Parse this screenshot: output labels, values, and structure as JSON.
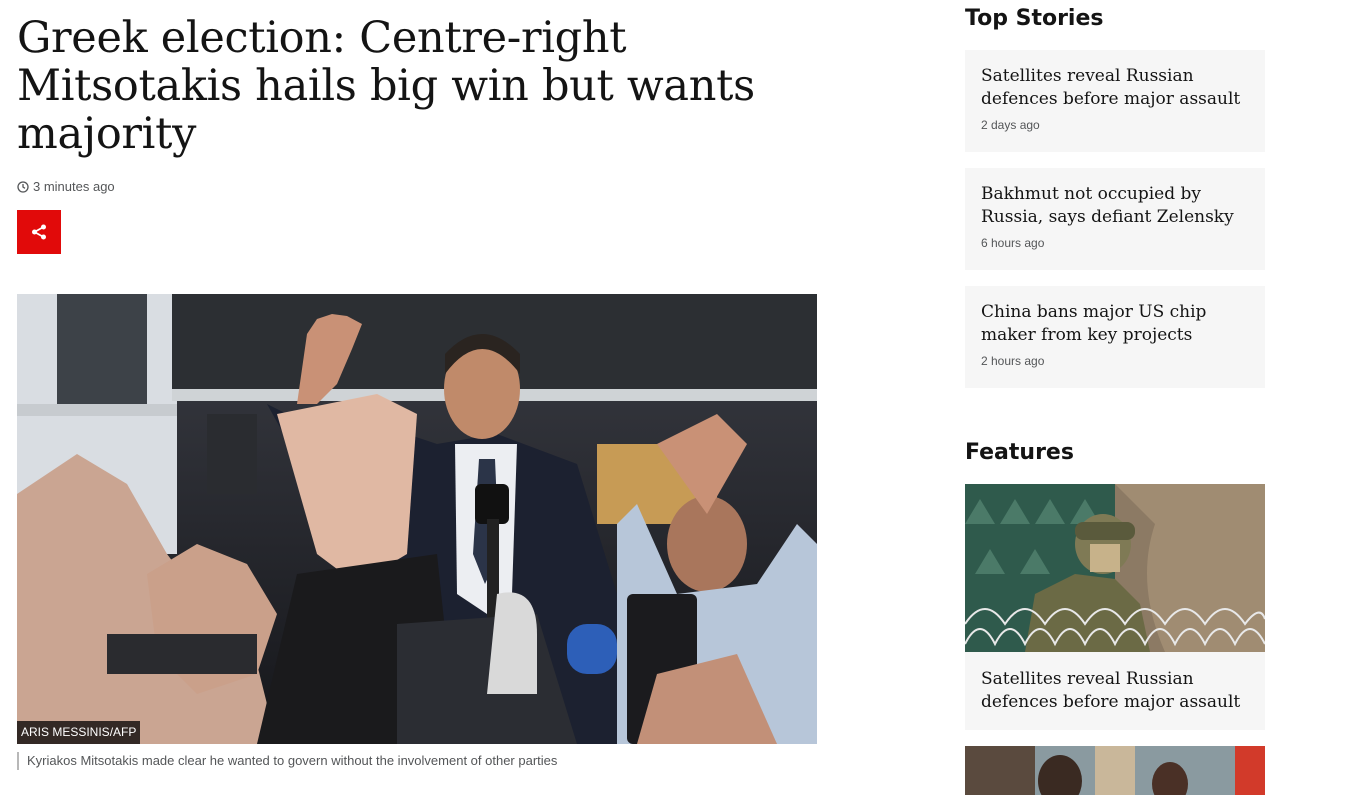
{
  "article": {
    "headline": "Greek election: Centre-right Mitsotakis hails big win but wants majority",
    "timestamp": "3 minutes ago",
    "share_icon": "share-icon",
    "image_credit": "ARIS MESSINIS/AFP",
    "image_caption": "Kyriakos Mitsotakis made clear he wanted to govern without the involvement of other parties",
    "accent_color": "#e10a0a"
  },
  "sidebar": {
    "top_stories_title": "Top Stories",
    "top_stories": [
      {
        "title": "Satellites reveal Russian defences before major assault",
        "time": "2 days ago"
      },
      {
        "title": "Bakhmut not occupied by Russia, says defiant Zelensky",
        "time": "6 hours ago"
      },
      {
        "title": "China bans major US chip maker from key projects",
        "time": "2 hours ago"
      }
    ],
    "features_title": "Features",
    "features": [
      {
        "title": "Satellites reveal Russian defences before major assault"
      }
    ]
  }
}
